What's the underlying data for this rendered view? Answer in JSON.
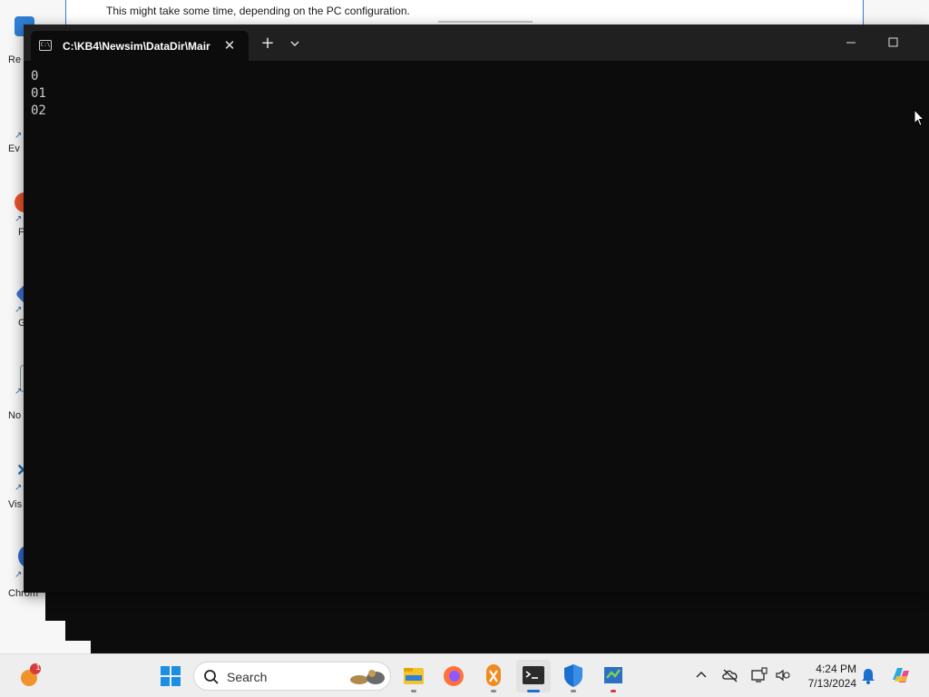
{
  "background_window": {
    "message": "This might take some time, depending on the PC configuration."
  },
  "desktop": {
    "icons": [
      {
        "label": "Re",
        "icon": "recycle-bin-icon"
      },
      {
        "label": "Ev",
        "icon": "shortcut-icon"
      },
      {
        "label": "F",
        "icon": "app-icon"
      },
      {
        "label": "G",
        "icon": "app-icon"
      },
      {
        "label": "No",
        "icon": "notepad-icon"
      },
      {
        "label": "Vis",
        "icon": "visual-studio-icon"
      },
      {
        "label": "Chrom",
        "icon": "chrome-icon"
      }
    ]
  },
  "terminal": {
    "tab_title": "C:\\KB4\\Newsim\\DataDir\\Mair",
    "tab_icon": "console-icon",
    "close_tab": "✕",
    "new_tab": "+",
    "output_lines": [
      "0",
      "01",
      "02"
    ]
  },
  "taskbar": {
    "weather_badge": "1",
    "search_placeholder": "Search",
    "clock_time": "4:24 PM",
    "clock_date": "7/13/2024",
    "pinned": [
      {
        "name": "start-icon"
      },
      {
        "name": "file-explorer-icon"
      },
      {
        "name": "firefox-icon"
      },
      {
        "name": "keepassxc-icon"
      },
      {
        "name": "terminal-icon",
        "active": true
      },
      {
        "name": "defender-icon"
      },
      {
        "name": "app-icon"
      }
    ],
    "tray_icons": [
      "chevron-up-icon",
      "cloud-offline-icon",
      "display-icon",
      "volume-icon",
      "notification-bell-icon",
      "copilot-icon"
    ],
    "colors": {
      "accent": "#1a6fd1",
      "terminal_bg": "#0c0c0c",
      "titlebar_bg": "#202020"
    }
  }
}
